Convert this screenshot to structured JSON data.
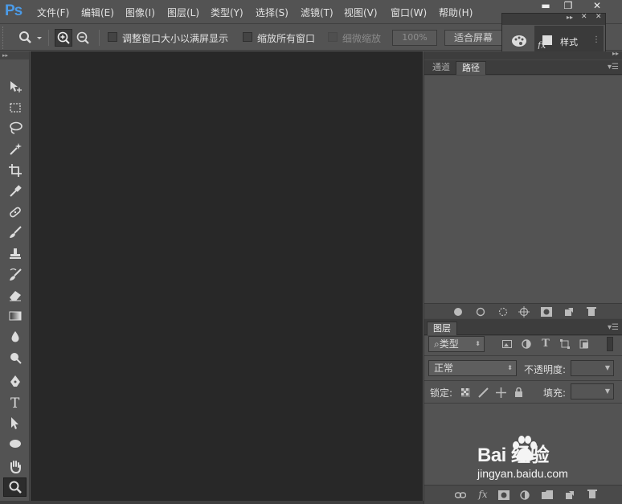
{
  "app": {
    "logo": "Ps"
  },
  "menu": [
    {
      "label": "文件(F)"
    },
    {
      "label": "编辑(E)"
    },
    {
      "label": "图像(I)"
    },
    {
      "label": "图层(L)"
    },
    {
      "label": "类型(Y)"
    },
    {
      "label": "选择(S)"
    },
    {
      "label": "滤镜(T)"
    },
    {
      "label": "视图(V)"
    },
    {
      "label": "窗口(W)"
    },
    {
      "label": "帮助(H)"
    }
  ],
  "window_controls": {
    "minimize": "▬",
    "maximize": "❐",
    "close": "✕"
  },
  "options": {
    "resize_windows_label": "调整窗口大小以满屏显示",
    "zoom_all_label": "缩放所有窗口",
    "scrubby_zoom_label": "细微缩放",
    "zoom_value": "100%",
    "fit_screen_label": "适合屏幕"
  },
  "floating_panel": {
    "styles_label": "样式",
    "dock_icons": [
      "palette-icon",
      "fx-styles-icon"
    ]
  },
  "tools": [
    "move-tool-icon",
    "marquee-tool-icon",
    "lasso-tool-icon",
    "magic-wand-icon",
    "crop-tool-icon",
    "eyedropper-icon",
    "healing-brush-icon",
    "brush-tool-icon",
    "clone-stamp-icon",
    "history-brush-icon",
    "eraser-icon",
    "gradient-tool-icon",
    "blur-tool-icon",
    "dodge-tool-icon",
    "pen-tool-icon",
    "type-tool-icon",
    "path-selection-icon",
    "ellipse-tool-icon",
    "hand-tool-icon",
    "zoom-tool-icon"
  ],
  "paths_panel": {
    "tabs": [
      {
        "label": "通道"
      },
      {
        "label": "路径"
      }
    ],
    "active_tab": "路径",
    "footer_icons": [
      "fill-path-icon",
      "stroke-path-icon",
      "load-selection-icon",
      "make-work-path-icon",
      "add-mask-icon",
      "new-path-icon",
      "delete-path-icon"
    ]
  },
  "layers_panel": {
    "tab": "图层",
    "filter_kind": "类型",
    "blend_mode": "正常",
    "opacity_label": "不透明度:",
    "lock_label": "锁定:",
    "fill_label": "填充:",
    "footer_icons": [
      "link-layers-icon",
      "fx-icon",
      "add-mask-icon",
      "adjustment-icon",
      "group-folder-icon",
      "new-layer-icon",
      "delete-layer-icon"
    ]
  },
  "watermark": {
    "logo": "Bai 经验",
    "url": "jingyan.baidu.com"
  },
  "colors": {
    "panel_bg": "#535353",
    "canvas_bg": "#282828",
    "logo_blue": "#4b9be8"
  }
}
